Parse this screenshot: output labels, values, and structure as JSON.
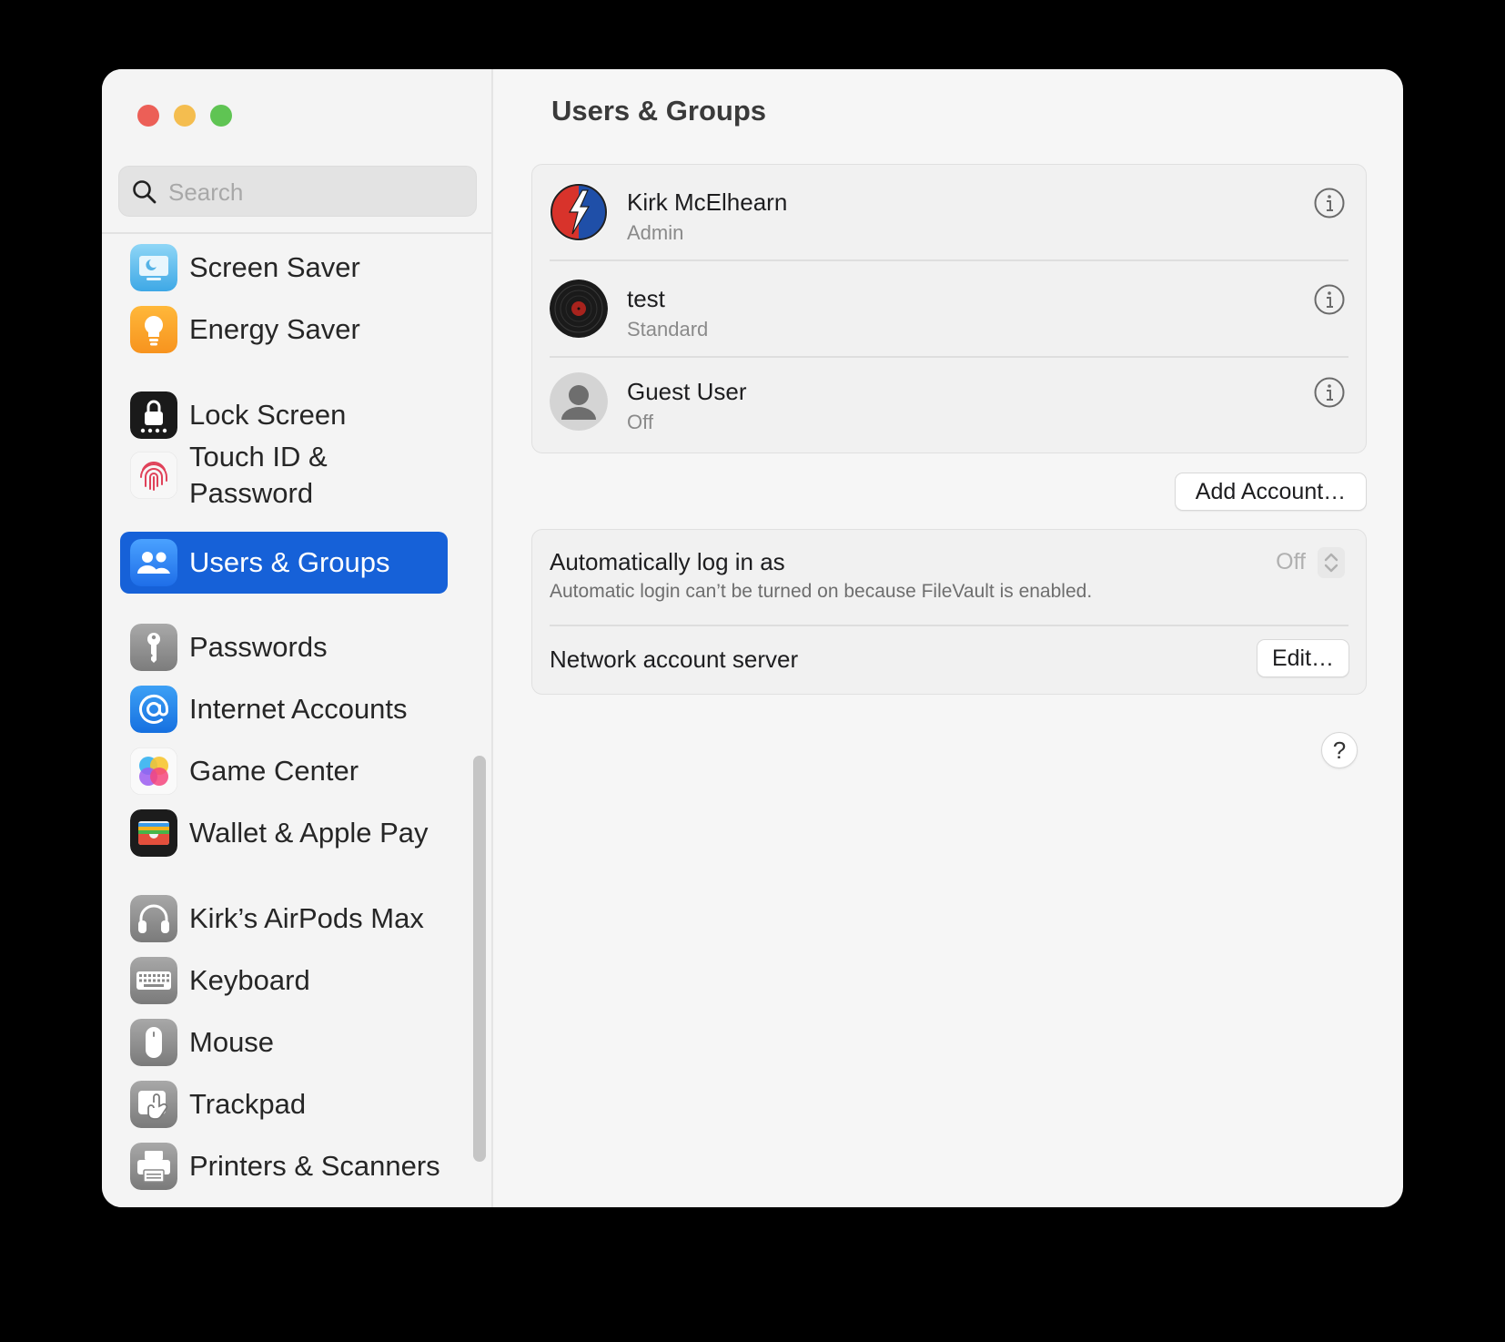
{
  "window": {
    "title": "Users & Groups"
  },
  "search": {
    "placeholder": "Search"
  },
  "sidebar": {
    "items": [
      {
        "label": "Screen Saver",
        "icon": "screen-saver-icon"
      },
      {
        "label": "Energy Saver",
        "icon": "energy-saver-icon"
      },
      {
        "label": "Lock Screen",
        "icon": "lock-screen-icon"
      },
      {
        "label": "Touch ID &",
        "label2": "Password",
        "icon": "fingerprint-icon"
      },
      {
        "label": "Users & Groups",
        "icon": "users-groups-icon",
        "selected": true
      },
      {
        "label": "Passwords",
        "icon": "key-icon"
      },
      {
        "label": "Internet Accounts",
        "icon": "at-sign-icon"
      },
      {
        "label": "Game Center",
        "icon": "game-center-icon"
      },
      {
        "label": "Wallet & Apple Pay",
        "icon": "wallet-icon"
      },
      {
        "label": "Kirk’s AirPods Max",
        "icon": "headphones-icon"
      },
      {
        "label": "Keyboard",
        "icon": "keyboard-icon"
      },
      {
        "label": "Mouse",
        "icon": "mouse-icon"
      },
      {
        "label": "Trackpad",
        "icon": "trackpad-icon"
      },
      {
        "label": "Printers & Scanners",
        "icon": "printer-icon"
      }
    ]
  },
  "users": [
    {
      "name": "Kirk McElhearn",
      "role": "Admin"
    },
    {
      "name": "test",
      "role": "Standard"
    },
    {
      "name": "Guest User",
      "role": "Off"
    }
  ],
  "add_account_label": "Add Account…",
  "auto_login": {
    "title": "Automatically log in as",
    "value": "Off",
    "subtitle": "Automatic login can’t be turned on because FileVault is enabled."
  },
  "network": {
    "label": "Network account server",
    "edit_label": "Edit…"
  },
  "help_label": "?",
  "colors": {
    "accent": "#1661d8",
    "close": "#ec5f57",
    "minimize": "#f4bd4f",
    "maximize": "#5fc453"
  }
}
